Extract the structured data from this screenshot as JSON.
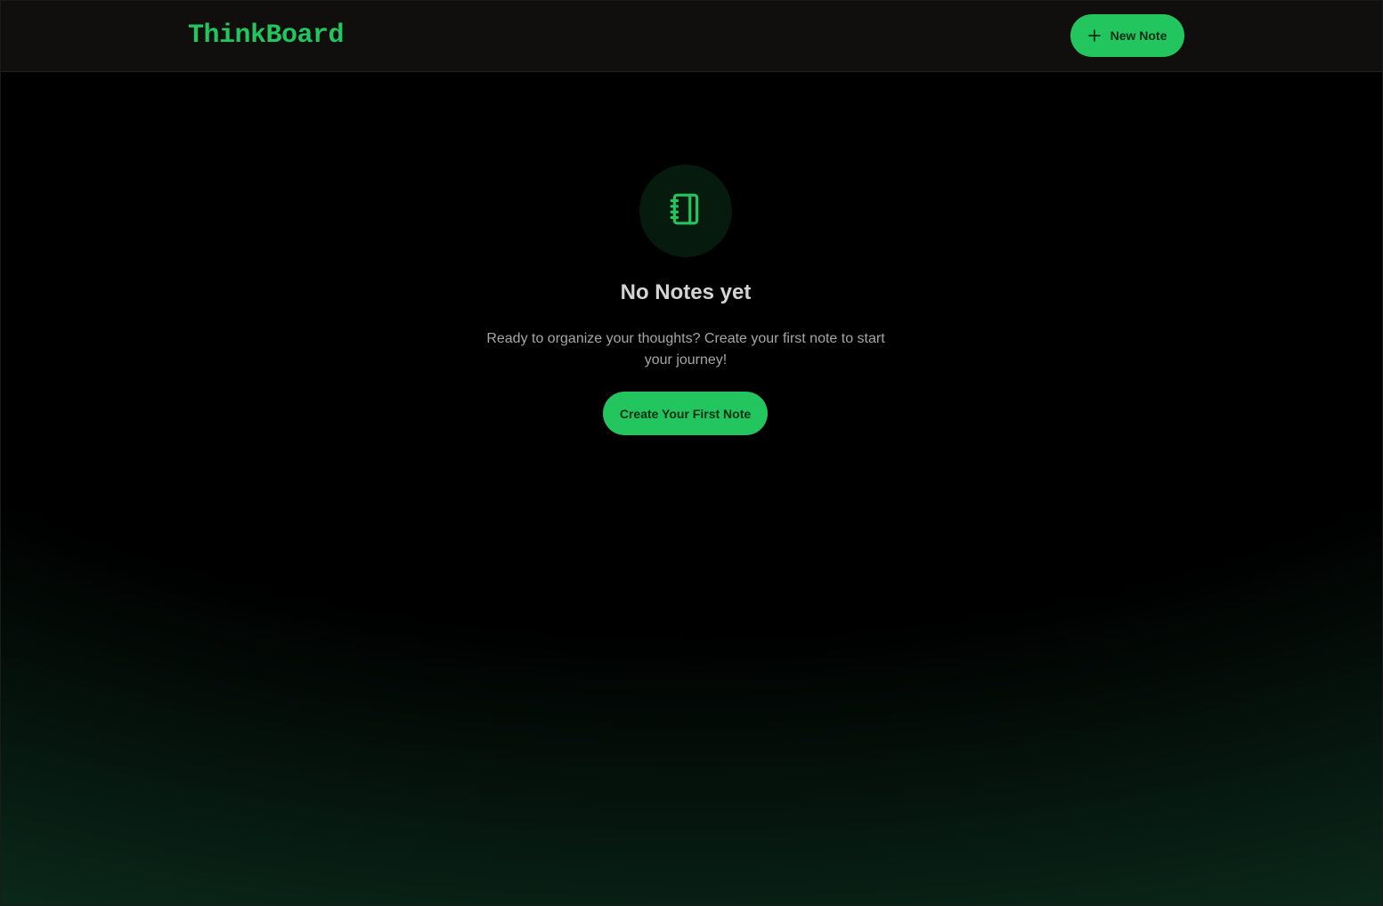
{
  "app": {
    "name": "ThinkBoard"
  },
  "header": {
    "new_note_label": "New Note",
    "new_note_icon": "plus-icon"
  },
  "empty_state": {
    "icon": "notebook-icon",
    "title": "No Notes yet",
    "description": "Ready to organize your thoughts? Create your first note to start your journey!",
    "cta_label": "Create Your First Note"
  },
  "colors": {
    "accent": "#22c55e",
    "accent_text": "#052e16",
    "header_bg": "#110e0e",
    "page_bg": "#000000",
    "bottom_glow": "#0b2a1b",
    "icon_circle_bg": "#071a0e",
    "title_text": "#d4d4d4",
    "body_text": "#a6a6a6"
  }
}
